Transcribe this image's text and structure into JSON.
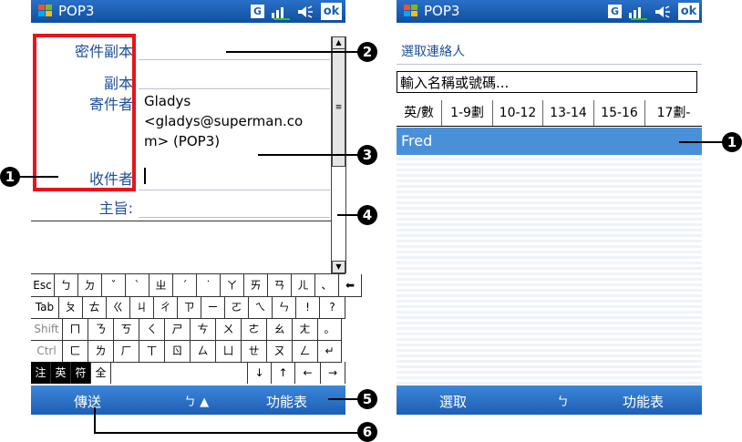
{
  "left_screen": {
    "title": "POP3",
    "ok_label": "ok",
    "g_label": "G",
    "fields": {
      "bcc_label": "密件副本",
      "cc_label": "副本",
      "from_label": "寄件者",
      "from_value_line1": "Gladys",
      "from_value_line2": "<gladys@superman.co",
      "from_value_line3": "m> (POP3)",
      "to_label": "收件者",
      "subject_label": "主旨:"
    },
    "keyboard": {
      "row1": [
        "Esc",
        "ㄅ",
        "ㄉ",
        "ˇ",
        "ˋ",
        "ㄓ",
        "ˊ",
        "˙",
        "ㄚ",
        "ㄞ",
        "ㄢ",
        "ㄦ",
        "、",
        "⬅"
      ],
      "row2": [
        "Tab",
        "ㄆ",
        "ㄊ",
        "ㄍ",
        "ㄐ",
        "ㄔ",
        "ㄗ",
        "ㄧ",
        "ㄛ",
        "ㄟ",
        "ㄣ",
        "!",
        "?"
      ],
      "row3": [
        "Shift",
        "ㄇ",
        "ㄋ",
        "ㄎ",
        "ㄑ",
        "ㄕ",
        "ㄘ",
        "ㄨ",
        "ㄜ",
        "ㄠ",
        "ㄤ",
        "。"
      ],
      "row4": [
        "Ctrl",
        "ㄈ",
        "ㄌ",
        "ㄏ",
        "ㄒ",
        "ㄖ",
        "ㄙ",
        "ㄩ",
        "ㄝ",
        "ㄡ",
        "ㄥ",
        "↵"
      ],
      "row5": [
        "注",
        "英",
        "符",
        "全",
        "",
        "↓",
        "↑",
        "←",
        "→"
      ]
    },
    "bottom": {
      "send_label": "傳送",
      "input_indicator": "ㄅ ▲",
      "menu_label": "功能表"
    }
  },
  "right_screen": {
    "title": "POP3",
    "ok_label": "ok",
    "g_label": "G",
    "heading": "選取連絡人",
    "search_placeholder": "輸入名稱或號碼...",
    "tabs": [
      "英/數",
      "1-9劃",
      "10-12",
      "13-14",
      "15-16",
      "17劃-"
    ],
    "contacts": [
      "Fred"
    ],
    "bottom": {
      "select_label": "選取",
      "input_indicator": "ㄅ",
      "menu_label": "功能表"
    }
  },
  "callouts": [
    "1",
    "2",
    "3",
    "4",
    "5",
    "6",
    "1"
  ],
  "colors": {
    "titlebar": "#1a5bb0",
    "label_blue": "#1d4f99",
    "highlight_box": "#e8141c",
    "selected_row": "#4a90d9"
  }
}
